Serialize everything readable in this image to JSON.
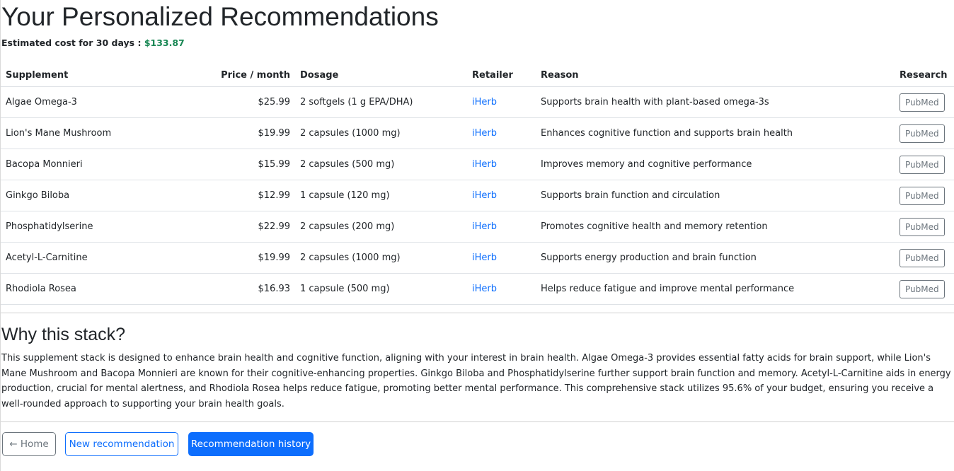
{
  "header": {
    "title": "Your Personalized Recommendations",
    "cost_label": "Estimated cost for 30 days :",
    "cost_value": "$133.87"
  },
  "table": {
    "columns": [
      "Supplement",
      "Price / month",
      "Dosage",
      "Retailer",
      "Reason",
      "Research"
    ],
    "rows": [
      {
        "supplement": "Algae Omega-3",
        "price": "$25.99",
        "dosage": "2 softgels (1 g EPA/DHA)",
        "retailer": "iHerb",
        "reason": "Supports brain health with plant-based omega-3s",
        "research": "PubMed"
      },
      {
        "supplement": "Lion's Mane Mushroom",
        "price": "$19.99",
        "dosage": "2 capsules (1000 mg)",
        "retailer": "iHerb",
        "reason": "Enhances cognitive function and supports brain health",
        "research": "PubMed"
      },
      {
        "supplement": "Bacopa Monnieri",
        "price": "$15.99",
        "dosage": "2 capsules (500 mg)",
        "retailer": "iHerb",
        "reason": "Improves memory and cognitive performance",
        "research": "PubMed"
      },
      {
        "supplement": "Ginkgo Biloba",
        "price": "$12.99",
        "dosage": "1 capsule (120 mg)",
        "retailer": "iHerb",
        "reason": "Supports brain function and circulation",
        "research": "PubMed"
      },
      {
        "supplement": "Phosphatidylserine",
        "price": "$22.99",
        "dosage": "2 capsules (200 mg)",
        "retailer": "iHerb",
        "reason": "Promotes cognitive health and memory retention",
        "research": "PubMed"
      },
      {
        "supplement": "Acetyl-L-Carnitine",
        "price": "$19.99",
        "dosage": "2 capsules (1000 mg)",
        "retailer": "iHerb",
        "reason": "Supports energy production and brain function",
        "research": "PubMed"
      },
      {
        "supplement": "Rhodiola Rosea",
        "price": "$16.93",
        "dosage": "1 capsule (500 mg)",
        "retailer": "iHerb",
        "reason": "Helps reduce fatigue and improve mental performance",
        "research": "PubMed"
      }
    ]
  },
  "why": {
    "heading": "Why this stack?",
    "text": "This supplement stack is designed to enhance brain health and cognitive function, aligning with your interest in brain health. Algae Omega-3 provides essential fatty acids for brain support, while Lion's Mane Mushroom and Bacopa Monnieri are known for their cognitive-enhancing properties. Ginkgo Biloba and Phosphatidylserine further support brain function and memory. Acetyl-L-Carnitine aids in energy production, crucial for mental alertness, and Rhodiola Rosea helps reduce fatigue, promoting better mental performance. This comprehensive stack utilizes 95.6% of your budget, ensuring you receive a well-rounded approach to supporting your brain health goals."
  },
  "actions": {
    "home": "← Home",
    "new": "New recommendation",
    "history": "Recommendation history"
  },
  "colors": {
    "primary": "#0d6efd",
    "success": "#198754",
    "secondary": "#6c757d"
  }
}
